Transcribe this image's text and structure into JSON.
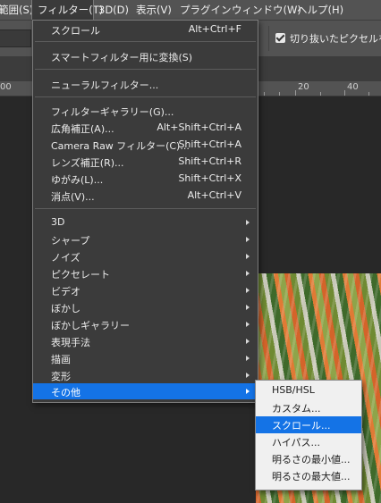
{
  "menubar": {
    "items": [
      {
        "label": "範囲(S)"
      },
      {
        "label": "フィルター(T)"
      },
      {
        "label": "3D(D)"
      },
      {
        "label": "表示(V)"
      },
      {
        "label": "プラグイン"
      },
      {
        "label": "ウィンドウ(W)"
      },
      {
        "label": "ヘルプ(H)"
      }
    ],
    "active": "フィルター(T)"
  },
  "options_bar": {
    "checkbox_checked": true,
    "checkbox_label": "切り抜いたピクセルを"
  },
  "ruler": {
    "labels": [
      "00",
      "20",
      "40"
    ]
  },
  "filter_menu": {
    "items": [
      {
        "label": "スクロール",
        "shortcut": "Alt+Ctrl+F"
      },
      {
        "label": "スマートフィルター用に変換(S)",
        "shortcut": ""
      },
      {
        "label": "ニューラルフィルター...",
        "shortcut": ""
      },
      {
        "label": "フィルターギャラリー(G)...",
        "shortcut": ""
      },
      {
        "label": "広角補正(A)...",
        "shortcut": "Alt+Shift+Ctrl+A"
      },
      {
        "label": "Camera Raw フィルター(C)...",
        "shortcut": "Shift+Ctrl+A"
      },
      {
        "label": "レンズ補正(R)...",
        "shortcut": "Shift+Ctrl+R"
      },
      {
        "label": "ゆがみ(L)...",
        "shortcut": "Shift+Ctrl+X"
      },
      {
        "label": "消点(V)...",
        "shortcut": "Alt+Ctrl+V"
      },
      {
        "label": "3D",
        "shortcut": ""
      },
      {
        "label": "シャープ",
        "shortcut": ""
      },
      {
        "label": "ノイズ",
        "shortcut": ""
      },
      {
        "label": "ピクセレート",
        "shortcut": ""
      },
      {
        "label": "ビデオ",
        "shortcut": ""
      },
      {
        "label": "ぼかし",
        "shortcut": ""
      },
      {
        "label": "ぼかしギャラリー",
        "shortcut": ""
      },
      {
        "label": "表現手法",
        "shortcut": ""
      },
      {
        "label": "描画",
        "shortcut": ""
      },
      {
        "label": "変形",
        "shortcut": ""
      },
      {
        "label": "その他",
        "shortcut": ""
      }
    ],
    "highlighted": "その他"
  },
  "other_submenu": {
    "items": [
      {
        "label": "HSB/HSL"
      },
      {
        "label": "カスタム..."
      },
      {
        "label": "スクロール..."
      },
      {
        "label": "ハイパス..."
      },
      {
        "label": "明るさの最小値..."
      },
      {
        "label": "明るさの最大値..."
      }
    ],
    "highlighted": "スクロール..."
  },
  "colors": {
    "menu_bg": "#3b3b3b",
    "highlight": "#1473e6",
    "submenu_bg": "#f0f0f0",
    "app_bg": "#535353"
  }
}
